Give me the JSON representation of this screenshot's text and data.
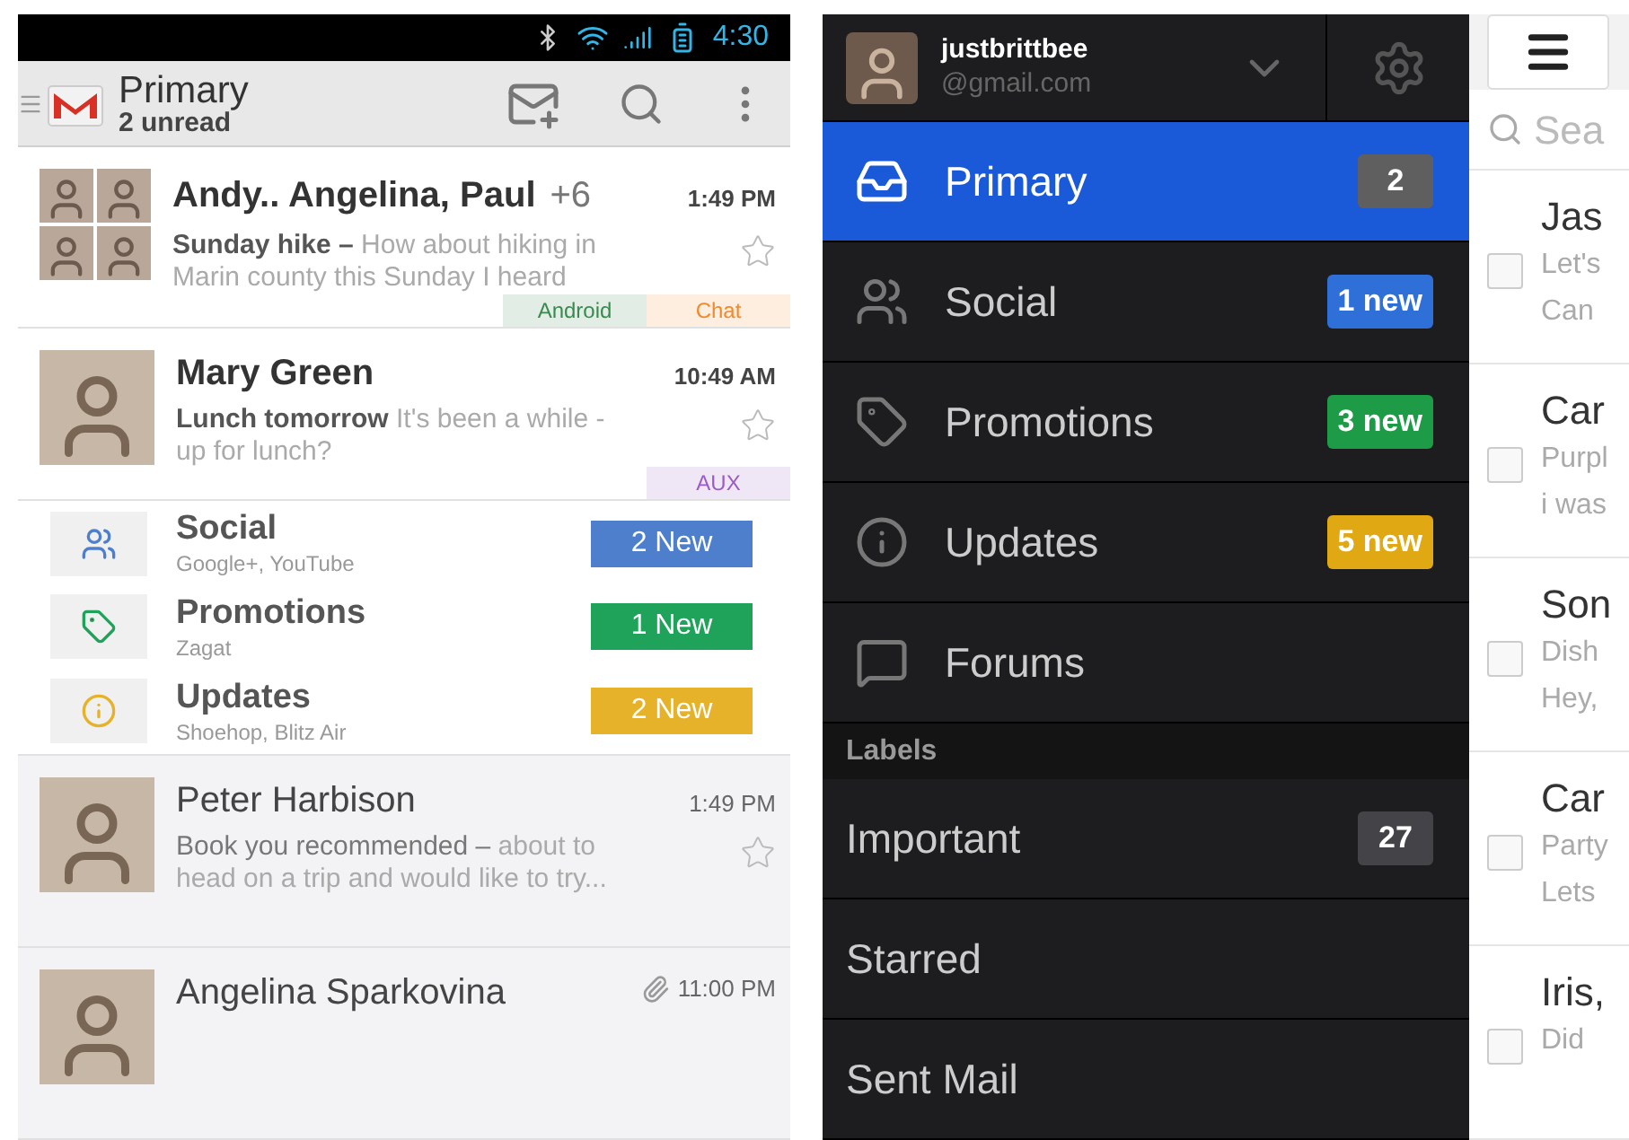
{
  "left_phone": {
    "status_bar": {
      "time": "4:30"
    },
    "toolbar": {
      "title": "Primary",
      "subtitle": "2 unread"
    },
    "conversations": [
      {
        "kind": "group",
        "unread": true,
        "senders": "Andy.. Angelina, Paul",
        "extra": "+6",
        "time": "1:49 PM",
        "attachment": false,
        "subject": "Sunday hike –",
        "snippet": "How about hiking in Marin county this Sunday I heard",
        "starred": false,
        "labels": [
          {
            "text": "Android",
            "color": "#3a8a4f"
          },
          {
            "text": "Chat",
            "color": "#f08a2c"
          }
        ]
      },
      {
        "kind": "single",
        "unread": true,
        "senders": "Mary Green",
        "time": "10:49 AM",
        "attachment": false,
        "subject": "Lunch tomorrow",
        "snippet": "It's been a while - up for lunch?",
        "starred": false,
        "labels": [
          {
            "text": "AUX",
            "color": "#9c5cc4"
          }
        ]
      }
    ],
    "categories": [
      {
        "kind": "social",
        "name": "Social",
        "sources": "Google+, YouTube",
        "badge": "2 New",
        "color": "#4d7fcc"
      },
      {
        "kind": "promotions",
        "name": "Promotions",
        "sources": "Zagat",
        "badge": "1 New",
        "color": "#1fa35a"
      },
      {
        "kind": "updates",
        "name": "Updates",
        "sources": "Shoehop, Blitz Air",
        "badge": "2 New",
        "color": "#e6b229"
      }
    ],
    "more_conversations": [
      {
        "kind": "single",
        "unread": false,
        "senders": "Peter Harbison",
        "time": "1:49 PM",
        "attachment": false,
        "subject": "Book you recommended –",
        "snippet": "about to head on a trip and would like to try...",
        "starred": false
      },
      {
        "kind": "single",
        "unread": false,
        "senders": "Angelina Sparkovina",
        "time": "11:00 PM",
        "attachment": true
      }
    ]
  },
  "right_phone": {
    "account": {
      "username": "justbrittbee",
      "email": "@gmail.com"
    },
    "drawer_items": [
      {
        "kind": "inbox",
        "label": "Primary",
        "selected": true,
        "badge": "2",
        "color": "#5f5f5f"
      },
      {
        "kind": "social",
        "label": "Social",
        "selected": false,
        "badge": "1 new",
        "color": "#2f6fd8"
      },
      {
        "kind": "promotions",
        "label": "Promotions",
        "selected": false,
        "badge": "3 new",
        "color": "#1d9b46"
      },
      {
        "kind": "updates",
        "label": "Updates",
        "selected": false,
        "badge": "5 new",
        "color": "#e0a812"
      },
      {
        "kind": "forums",
        "label": "Forums",
        "selected": false
      }
    ],
    "labels_header": "Labels",
    "labels": [
      {
        "label": "Important",
        "selected": false,
        "badge": "27"
      },
      {
        "label": "Starred",
        "selected": false
      },
      {
        "label": "Sent Mail",
        "selected": false
      }
    ],
    "list_peek": {
      "search": {
        "placeholder": "Sea"
      },
      "messages": [
        {
          "sender": "Jas",
          "lines": [
            "Let's",
            "Can"
          ],
          "checked": false
        },
        {
          "sender": "Car",
          "lines": [
            "Purpl",
            "i was"
          ],
          "checked": false
        },
        {
          "sender": "Son",
          "lines": [
            "Dish",
            "Hey,"
          ],
          "checked": false
        },
        {
          "sender": "Car",
          "lines": [
            "Party",
            "Lets"
          ],
          "checked": false
        },
        {
          "sender": "Iris,",
          "lines": [
            "Did"
          ],
          "checked": false
        }
      ]
    }
  }
}
